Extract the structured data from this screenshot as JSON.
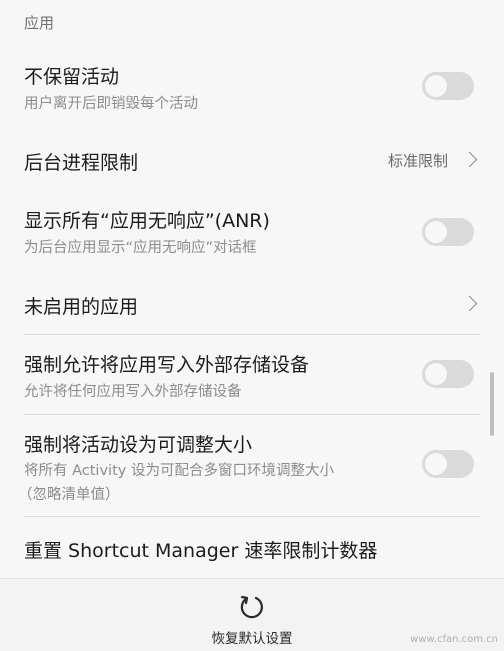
{
  "section": {
    "header": "应用"
  },
  "items": [
    {
      "title": "不保留活动",
      "subtitle": "用户离开后即销毁每个活动",
      "type": "toggle",
      "on": false
    },
    {
      "title": "后台进程限制",
      "value": "标准限制",
      "type": "chevron"
    },
    {
      "title": "显示所有“应用无响应”(ANR)",
      "subtitle": "为后台应用显示“应用无响应”对话框",
      "type": "toggle",
      "on": false
    },
    {
      "title": "未启用的应用",
      "type": "chevron"
    },
    {
      "title": "强制允许将应用写入外部存储设备",
      "subtitle": "允许将任何应用写入外部存储设备",
      "type": "toggle",
      "on": false
    },
    {
      "title": "强制将活动设为可调整大小",
      "subtitle": "将所有 Activity 设为可配合多窗口环境调整大小",
      "subtitle2": "（忽略清单值）",
      "type": "toggle",
      "on": false
    },
    {
      "title": "重置 Shortcut Manager 速率限制计数器",
      "type": "action"
    }
  ],
  "bottom_bar": {
    "reset_label": "恢复默认设置",
    "icon": "reset-icon"
  },
  "watermark": "www.cfan.com.cn",
  "colors": {
    "background": "#f7f7f7",
    "toggle_off": "#dadada",
    "divider": "#dcdcdc"
  }
}
